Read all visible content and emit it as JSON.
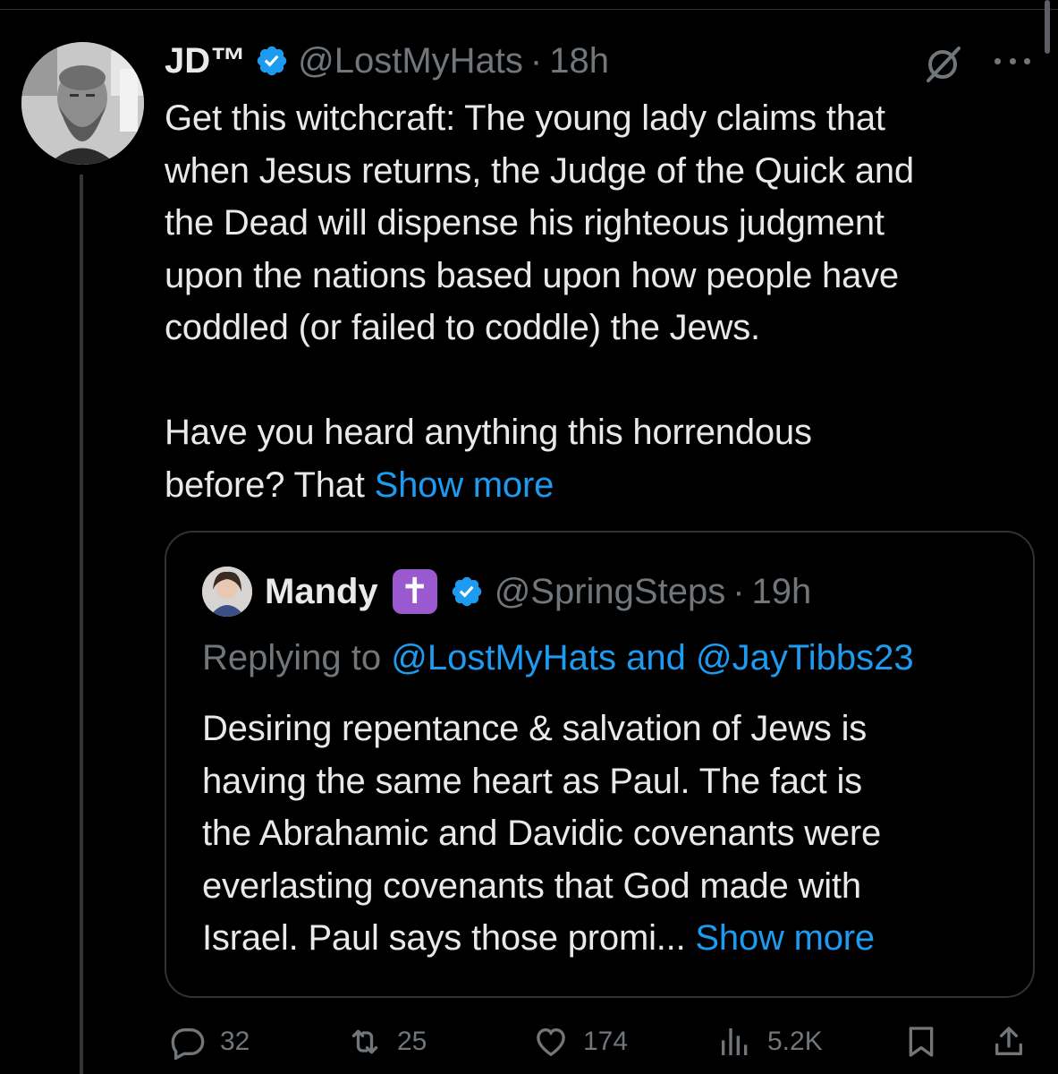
{
  "tweet": {
    "display_name": "JD™",
    "handle": "@LostMyHats",
    "separator": "·",
    "time": "18h",
    "text_lines": [
      "Get this witchcraft: The young lady claims that",
      "when Jesus returns, the Judge of the Quick and",
      "the Dead will dispense his righteous judgment",
      "upon the nations based upon how people have",
      "coddled (or failed to coddle) the Jews."
    ],
    "text_lines_2": [
      "Have you heard anything this horrendous",
      "before? That"
    ],
    "show_more": "Show more"
  },
  "quote": {
    "display_name": "Mandy",
    "badge_emoji": "✝",
    "handle": "@SpringSteps",
    "separator": "·",
    "time": "19h",
    "replying_prefix": "Replying to",
    "replying_to": "@LostMyHats and @JayTibbs23",
    "text_lines": [
      "Desiring repentance & salvation of Jews is",
      "having the same heart as Paul. The fact is",
      "the Abrahamic and Davidic covenants were",
      "everlasting covenants that God made with"
    ],
    "last_line": "Israel. Paul says those promi...",
    "show_more": "Show more"
  },
  "actions": {
    "replies": "32",
    "reposts": "25",
    "likes": "174",
    "views": "5.2K"
  },
  "colors": {
    "background": "#000000",
    "text": "#e7e9ea",
    "muted": "#71767b",
    "link": "#1d9bf0",
    "border": "#2f3336",
    "verified": "#1d9bf0",
    "cross_badge": "#9b59d0"
  },
  "icons": {
    "verified": "verified-badge-icon",
    "grok": "grok-icon",
    "more": "more-options-icon",
    "reply": "reply-icon",
    "repost": "repost-icon",
    "like": "heart-icon",
    "views": "views-icon",
    "bookmark": "bookmark-icon",
    "share": "share-icon"
  }
}
